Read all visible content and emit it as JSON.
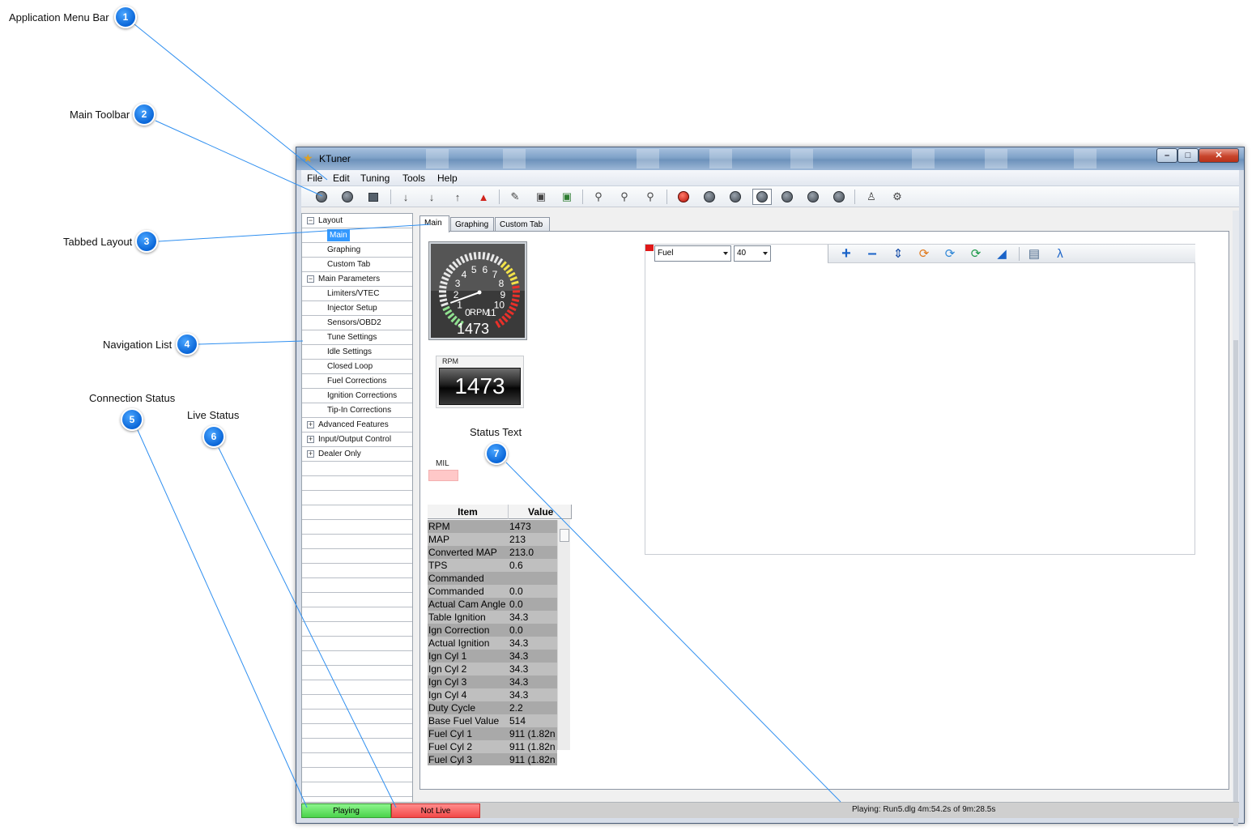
{
  "window": {
    "title": "KTuner"
  },
  "menu": [
    "File",
    "Edit",
    "Tuning",
    "Tools",
    "Help"
  ],
  "nav": [
    {
      "label": "Layout",
      "level": 0,
      "expander": "minus"
    },
    {
      "label": "Main",
      "level": 1,
      "selected": true
    },
    {
      "label": "Graphing",
      "level": 1
    },
    {
      "label": "Custom Tab",
      "level": 1
    },
    {
      "label": "Main Parameters",
      "level": 0,
      "expander": "minus"
    },
    {
      "label": "Limiters/VTEC",
      "level": 1
    },
    {
      "label": "Injector Setup",
      "level": 1
    },
    {
      "label": "Sensors/OBD2",
      "level": 1
    },
    {
      "label": "Tune Settings",
      "level": 1
    },
    {
      "label": "Idle Settings",
      "level": 1
    },
    {
      "label": "Closed Loop",
      "level": 1
    },
    {
      "label": "Fuel Corrections",
      "level": 1
    },
    {
      "label": "Ignition Corrections",
      "level": 1
    },
    {
      "label": "Tip-In Corrections",
      "level": 1
    },
    {
      "label": "Advanced Features",
      "level": 0,
      "expander": "plus"
    },
    {
      "label": "Input/Output Control",
      "level": 0,
      "expander": "plus"
    },
    {
      "label": "Dealer Only",
      "level": 0,
      "expander": "plus"
    }
  ],
  "tabs": [
    "Main",
    "Graphing",
    "Custom Tab"
  ],
  "gauge": {
    "ticks": [
      "0",
      "1",
      "2",
      "3",
      "4",
      "5",
      "6",
      "7",
      "8",
      "9",
      "10",
      "11"
    ],
    "unit": "RPM",
    "value": "1473"
  },
  "digital": {
    "label": "RPM",
    "value": "1473"
  },
  "mil": {
    "label": "MIL"
  },
  "grid": {
    "headers": [
      "Item",
      "Value"
    ],
    "rows": [
      [
        "RPM",
        "1473"
      ],
      [
        "MAP",
        "213"
      ],
      [
        "Converted MAP",
        "213.0"
      ],
      [
        "TPS",
        "0.6"
      ],
      [
        "Commanded",
        ""
      ],
      [
        "Commanded",
        "0.0"
      ],
      [
        "Actual Cam Angle",
        "0.0"
      ],
      [
        "Table Ignition",
        "34.3"
      ],
      [
        "Ign Correction",
        "0.0"
      ],
      [
        "Actual Ignition",
        "34.3"
      ],
      [
        "Ign Cyl 1",
        "34.3"
      ],
      [
        "Ign Cyl 2",
        "34.3"
      ],
      [
        "Ign Cyl 3",
        "34.3"
      ],
      [
        "Ign Cyl 4",
        "34.3"
      ],
      [
        "Duty Cycle",
        "2.2"
      ],
      [
        "Base Fuel Value",
        "514"
      ],
      [
        "Fuel Cyl 1",
        "911  (1.82n"
      ],
      [
        "Fuel Cyl 2",
        "911  (1.82n"
      ],
      [
        "Fuel Cyl 3",
        "911  (1.82n"
      ]
    ]
  },
  "map_editor": {
    "table_select": "Fuel",
    "zoom_select": "40"
  },
  "status": {
    "connection": "Playing",
    "live": "Not Live",
    "text": "Playing: Run5.dlg 4m:54.2s of 9m:28.5s"
  },
  "callouts": [
    {
      "num": "1",
      "label": "Application Menu Bar"
    },
    {
      "num": "2",
      "label": "Main Toolbar"
    },
    {
      "num": "3",
      "label": "Tabbed Layout"
    },
    {
      "num": "4",
      "label": "Navigation List"
    },
    {
      "num": "5",
      "label": "Connection Status"
    },
    {
      "num": "6",
      "label": "Live Status"
    },
    {
      "num": "7",
      "label": "Status Text"
    }
  ],
  "colors": {
    "callout_badge": "#0a66d8",
    "callout_line": "#2f8ff0",
    "nav_selected": "#3399ff",
    "status_connected": "#4bd34b",
    "status_not_live": "#f24848",
    "mil_off": "#ffc8c8"
  }
}
